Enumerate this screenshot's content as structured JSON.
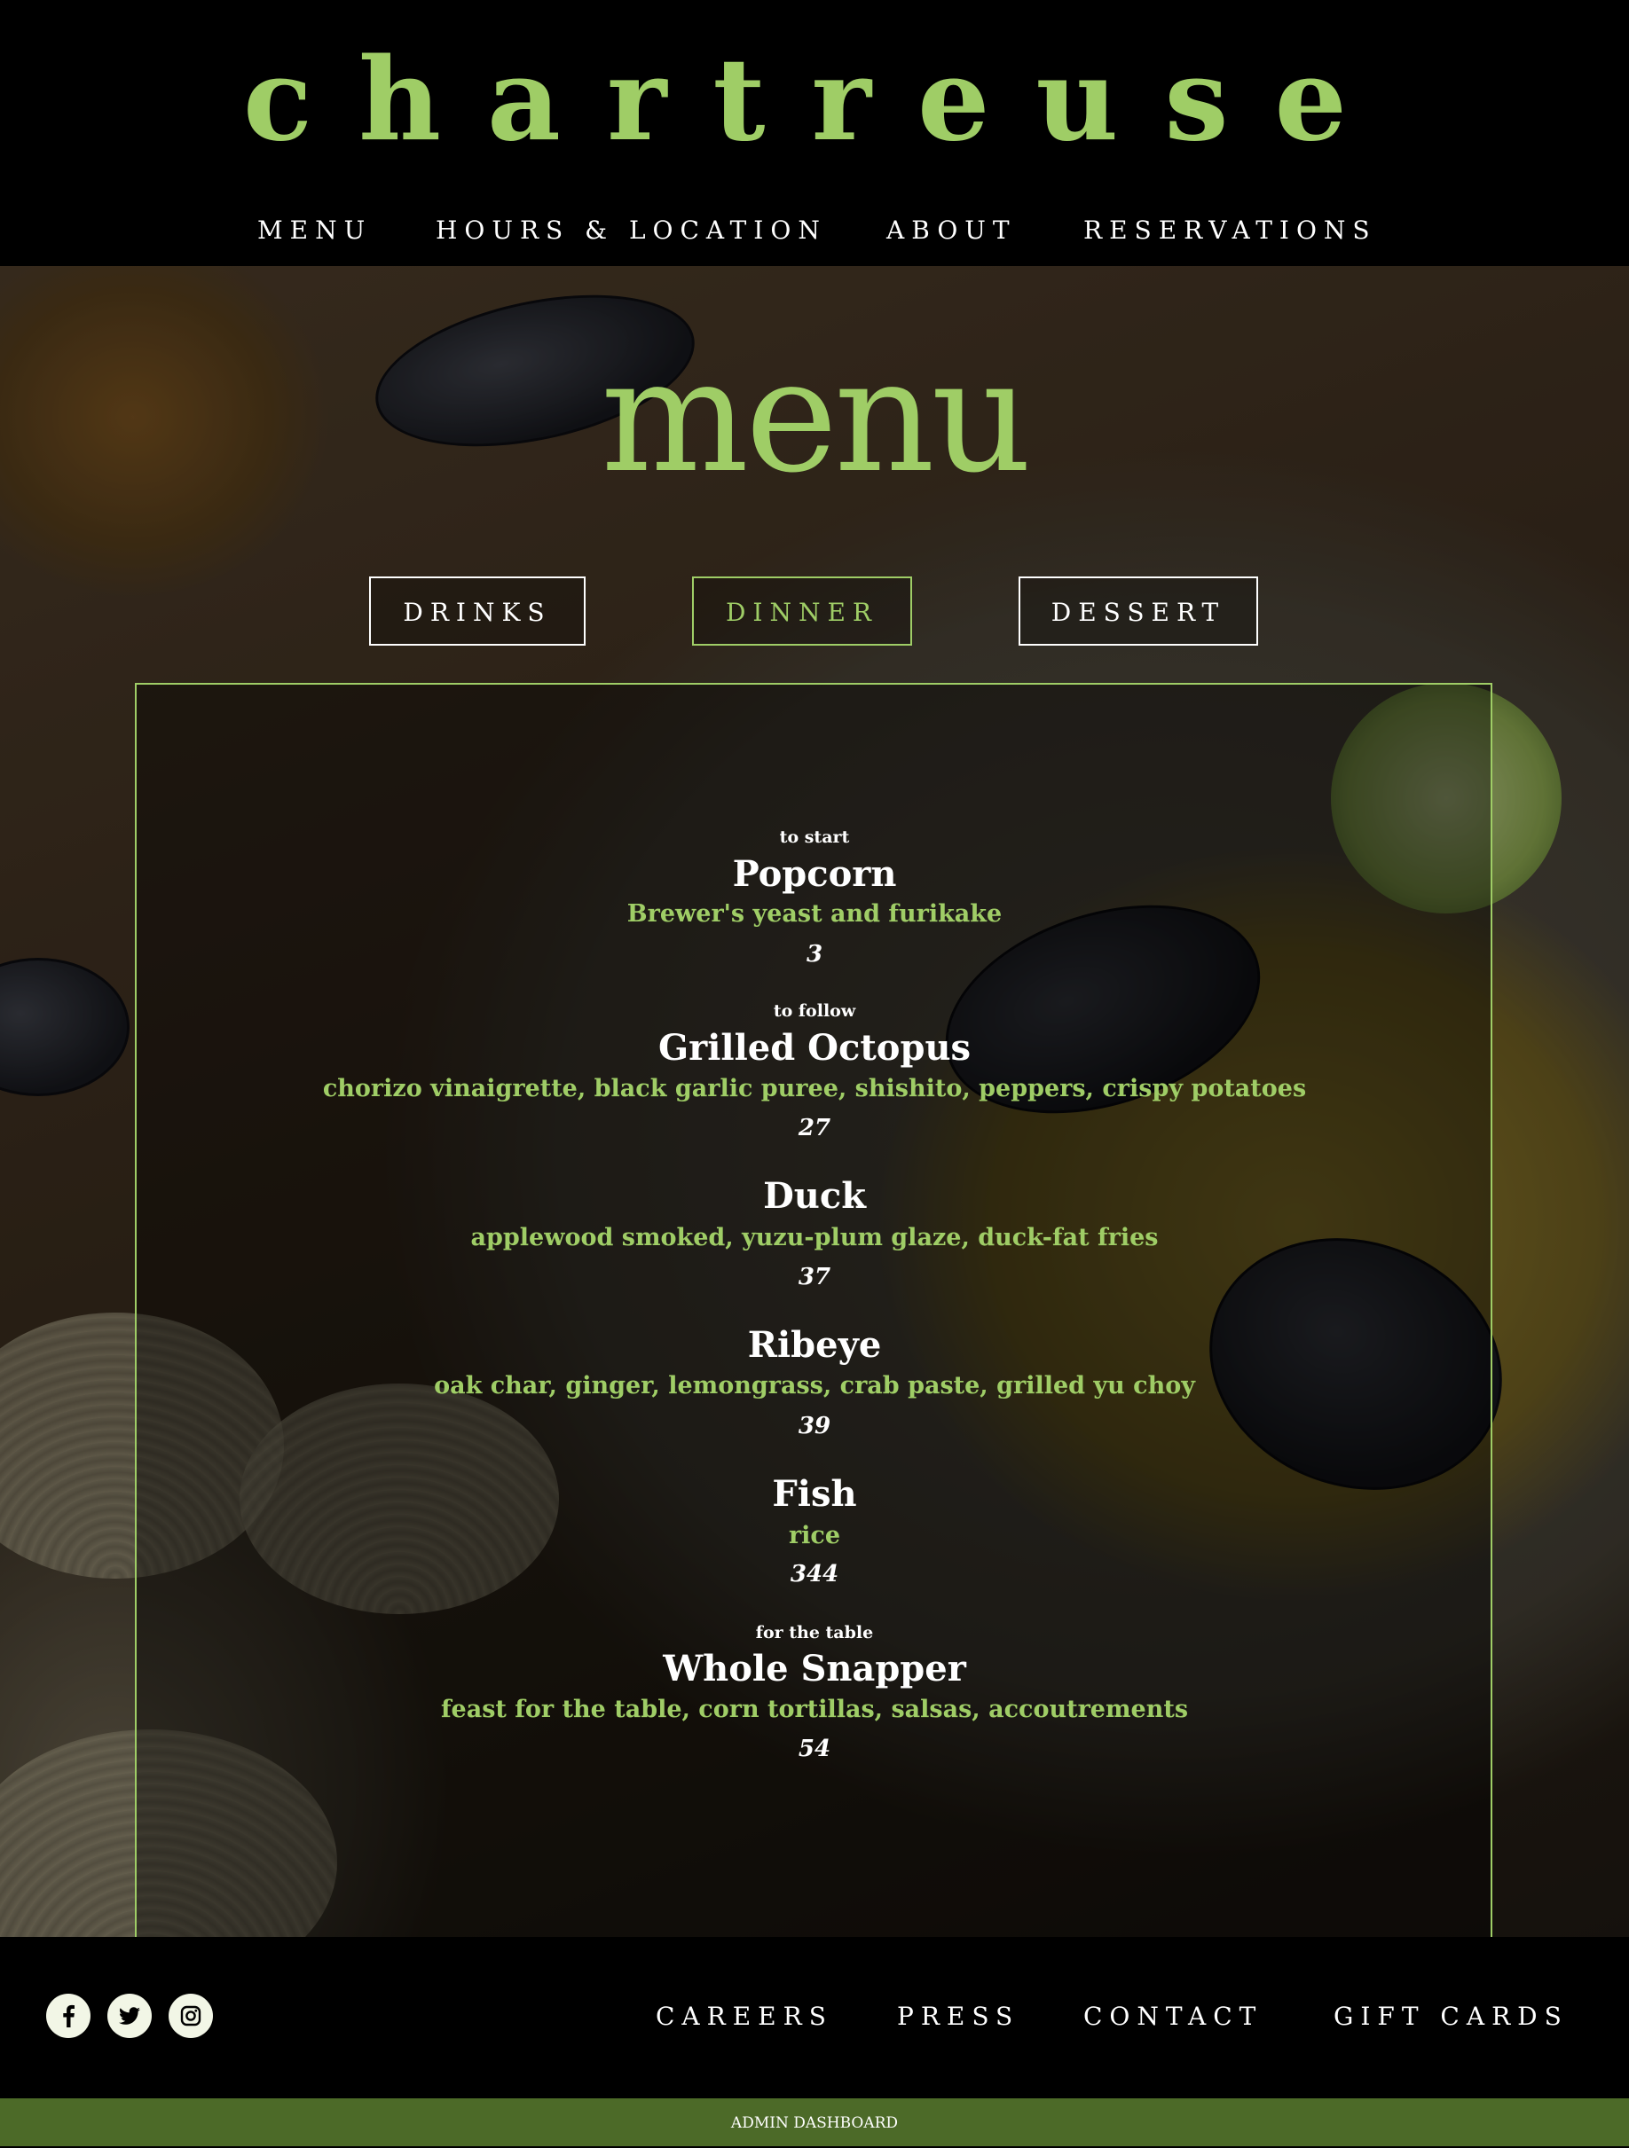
{
  "brand": {
    "logo": "chartreuse",
    "accent_color": "#9fcd66",
    "admin_bar_color": "#4c6a28"
  },
  "nav": {
    "items": [
      {
        "label": "MENU"
      },
      {
        "label": "HOURS & LOCATION"
      },
      {
        "label": "ABOUT"
      },
      {
        "label": "RESERVATIONS"
      }
    ]
  },
  "page": {
    "title": "menu"
  },
  "tabs": [
    {
      "label": "DRINKS",
      "active": false
    },
    {
      "label": "DINNER",
      "active": true
    },
    {
      "label": "DESSERT",
      "active": false
    }
  ],
  "menu": {
    "items": [
      {
        "course": "to start",
        "name": "Popcorn",
        "description": "Brewer's yeast and furikake",
        "price": "3"
      },
      {
        "course": "to follow",
        "name": "Grilled Octopus",
        "description": "chorizo vinaigrette, black garlic puree, shishito, peppers, crispy potatoes",
        "price": "27"
      },
      {
        "course": "",
        "name": "Duck",
        "description": "applewood smoked, yuzu-plum glaze, duck-fat fries",
        "price": "37"
      },
      {
        "course": "",
        "name": "Ribeye",
        "description": "oak char, ginger, lemongrass, crab paste, grilled yu choy",
        "price": "39"
      },
      {
        "course": "",
        "name": "Fish",
        "description": "rice",
        "price": "344"
      },
      {
        "course": "for the table",
        "name": "Whole Snapper",
        "description": "feast for the table, corn tortillas, salsas, accoutrements",
        "price": "54"
      }
    ]
  },
  "footer": {
    "social": [
      {
        "icon": "facebook-icon"
      },
      {
        "icon": "twitter-icon"
      },
      {
        "icon": "instagram-icon"
      }
    ],
    "links": [
      {
        "label": "CAREERS"
      },
      {
        "label": "PRESS"
      },
      {
        "label": "CONTACT"
      },
      {
        "label": "GIFT CARDS"
      }
    ]
  },
  "admin": {
    "label": "ADMIN DASHBOARD"
  }
}
